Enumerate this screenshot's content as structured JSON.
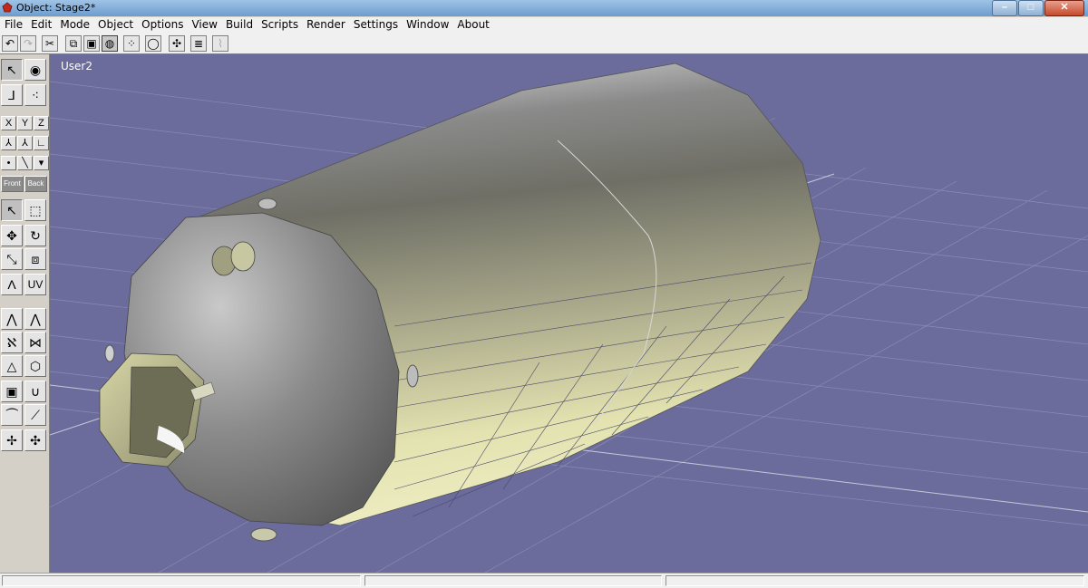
{
  "window": {
    "title": "Object: Stage2*",
    "minimize_label": "–",
    "maximize_label": "□",
    "close_label": "✕"
  },
  "menu": [
    "File",
    "Edit",
    "Mode",
    "Object",
    "Options",
    "View",
    "Build",
    "Scripts",
    "Render",
    "Settings",
    "Window",
    "About"
  ],
  "toolbar": {
    "buttons": [
      "undo-icon",
      "redo-icon",
      "cut-icon",
      "copy-icon",
      "paste-icon",
      "sphere-view-icon",
      "four-views-icon",
      "orbit-icon",
      "add-point-icon",
      "list-icon",
      "graph-icon"
    ]
  },
  "palette": {
    "axis_x": "X",
    "axis_y": "Y",
    "axis_z": "Z",
    "front_label": "Front",
    "back_label": "Back",
    "uv_label": "UV"
  },
  "viewport": {
    "label": "User2",
    "background_color": "#6b6b9c"
  }
}
